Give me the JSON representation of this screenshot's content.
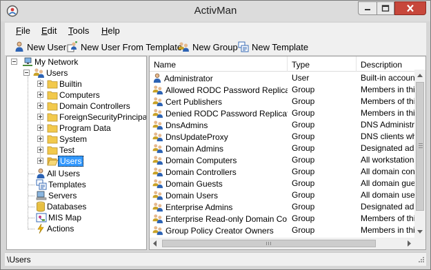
{
  "window": {
    "title": "ActivMan"
  },
  "menu": [
    {
      "underline": "F",
      "rest": "ile"
    },
    {
      "underline": "E",
      "rest": "dit"
    },
    {
      "underline": "T",
      "rest": "ools"
    },
    {
      "underline": "H",
      "rest": "elp"
    }
  ],
  "toolbar": {
    "new_user": "New User",
    "new_user_template": "New User From Template",
    "new_group": "New Group",
    "new_template": "New Template"
  },
  "tree": {
    "root": "My Network",
    "users": "Users",
    "children": [
      "Builtin",
      "Computers",
      "Domain Controllers",
      "ForeignSecurityPrincipals",
      "Program Data",
      "System",
      "Test",
      "Users"
    ],
    "all_users": "All Users",
    "templates": "Templates",
    "servers": "Servers",
    "databases": "Databases",
    "mis_map": "MIS Map",
    "actions": "Actions"
  },
  "list": {
    "headers": {
      "name": "Name",
      "type": "Type",
      "description": "Description"
    },
    "rows": [
      {
        "name": "Administrator",
        "type": "User",
        "desc": "Built-in account f",
        "icon": "user-icon"
      },
      {
        "name": "Allowed RODC Password Replicati...",
        "type": "Group",
        "desc": "Members in this",
        "icon": "group-icon"
      },
      {
        "name": "Cert Publishers",
        "type": "Group",
        "desc": "Members of this",
        "icon": "group-icon"
      },
      {
        "name": "Denied RODC Password Replicatio...",
        "type": "Group",
        "desc": "Members in this",
        "icon": "group-icon"
      },
      {
        "name": "DnsAdmins",
        "type": "Group",
        "desc": "DNS Administrat",
        "icon": "group-icon"
      },
      {
        "name": "DnsUpdateProxy",
        "type": "Group",
        "desc": "DNS clients who",
        "icon": "group-icon"
      },
      {
        "name": "Domain Admins",
        "type": "Group",
        "desc": "Designated adm",
        "icon": "group-icon"
      },
      {
        "name": "Domain Computers",
        "type": "Group",
        "desc": "All workstations",
        "icon": "group-icon"
      },
      {
        "name": "Domain Controllers",
        "type": "Group",
        "desc": "All domain contr",
        "icon": "group-icon"
      },
      {
        "name": "Domain Guests",
        "type": "Group",
        "desc": "All domain guest",
        "icon": "group-icon"
      },
      {
        "name": "Domain Users",
        "type": "Group",
        "desc": "All domain users",
        "icon": "group-icon"
      },
      {
        "name": "Enterprise Admins",
        "type": "Group",
        "desc": "Designated adm",
        "icon": "group-icon"
      },
      {
        "name": "Enterprise Read-only Domain Contr...",
        "type": "Group",
        "desc": "Members of this",
        "icon": "group-icon"
      },
      {
        "name": "Group Policy Creator Owners",
        "type": "Group",
        "desc": "Members in this",
        "icon": "group-icon"
      }
    ]
  },
  "status": {
    "path": "\\Users"
  },
  "colors": {
    "selection": "#3399ff",
    "close_button": "#c7473b",
    "folder": "#f2c94c"
  }
}
